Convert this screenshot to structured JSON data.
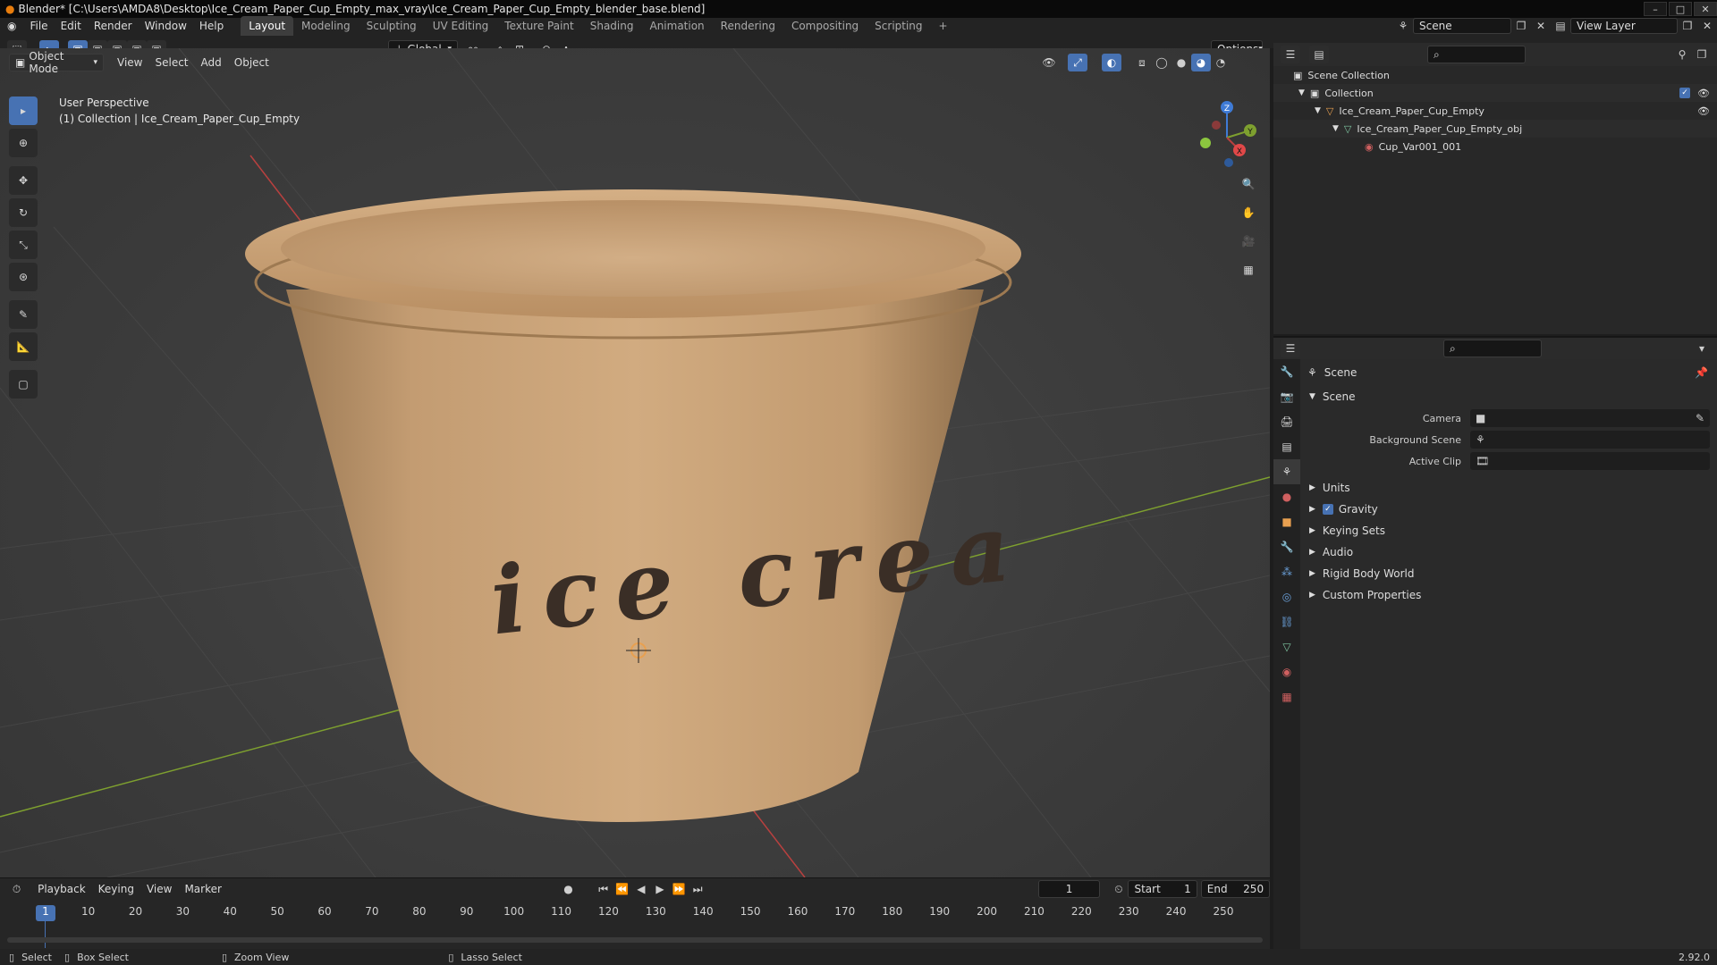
{
  "title_bar": {
    "text": "Blender* [C:\\Users\\AMDA8\\Desktop\\Ice_Cream_Paper_Cup_Empty_max_vray\\Ice_Cream_Paper_Cup_Empty_blender_base.blend]"
  },
  "menu": [
    "File",
    "Edit",
    "Render",
    "Window",
    "Help"
  ],
  "workspaces": [
    "Layout",
    "Modeling",
    "Sculpting",
    "UV Editing",
    "Texture Paint",
    "Shading",
    "Animation",
    "Rendering",
    "Compositing",
    "Scripting"
  ],
  "scene_selector": "Scene",
  "view_layer_selector": "View Layer",
  "header_tools": {
    "transform_orientation": "Global",
    "options": "Options"
  },
  "viewport_header": {
    "mode": "Object Mode",
    "menus": [
      "View",
      "Select",
      "Add",
      "Object"
    ]
  },
  "viewport": {
    "perspective_label": "User Perspective",
    "collection_label": "(1) Collection | Ice_Cream_Paper_Cup_Empty",
    "cup_text": "ice crea",
    "gizmo": {
      "x": "X",
      "y": "Y",
      "z": "Z"
    }
  },
  "timeline": {
    "menus": [
      "Playback",
      "Keying",
      "View",
      "Marker"
    ],
    "current_frame": "1",
    "start_label": "Start",
    "start": "1",
    "end_label": "End",
    "end": "250",
    "ticks": [
      "1",
      "10",
      "20",
      "30",
      "40",
      "50",
      "60",
      "70",
      "80",
      "90",
      "100",
      "110",
      "120",
      "130",
      "140",
      "150",
      "160",
      "170",
      "180",
      "190",
      "200",
      "210",
      "220",
      "230",
      "240",
      "250"
    ]
  },
  "statusbar": {
    "select": "Select",
    "box_select": "Box Select",
    "zoom_view": "Zoom View",
    "lasso_select": "Lasso Select",
    "version": "2.92.0"
  },
  "outliner": {
    "items": [
      {
        "label": "Scene Collection",
        "icon": "scene-collection-icon"
      },
      {
        "label": "Collection",
        "icon": "collection-icon"
      },
      {
        "label": "Ice_Cream_Paper_Cup_Empty",
        "icon": "empty-object-icon"
      },
      {
        "label": "Ice_Cream_Paper_Cup_Empty_obj",
        "icon": "mesh-icon"
      },
      {
        "label": "Cup_Var001_001",
        "icon": "material-icon"
      }
    ]
  },
  "properties": {
    "header": "Scene",
    "section": "Scene",
    "fields": [
      {
        "label": "Camera",
        "value": ""
      },
      {
        "label": "Background Scene",
        "value": ""
      },
      {
        "label": "Active Clip",
        "value": ""
      }
    ],
    "panels": [
      "Units",
      "Gravity",
      "Keying Sets",
      "Audio",
      "Rigid Body World",
      "Custom Properties"
    ]
  },
  "colors": {
    "accent": "#4772b3",
    "cup": "#c9a47a",
    "axis_x": "#b8403f",
    "axis_y": "#7ea02f",
    "axis_z": "#3f7bd6"
  }
}
